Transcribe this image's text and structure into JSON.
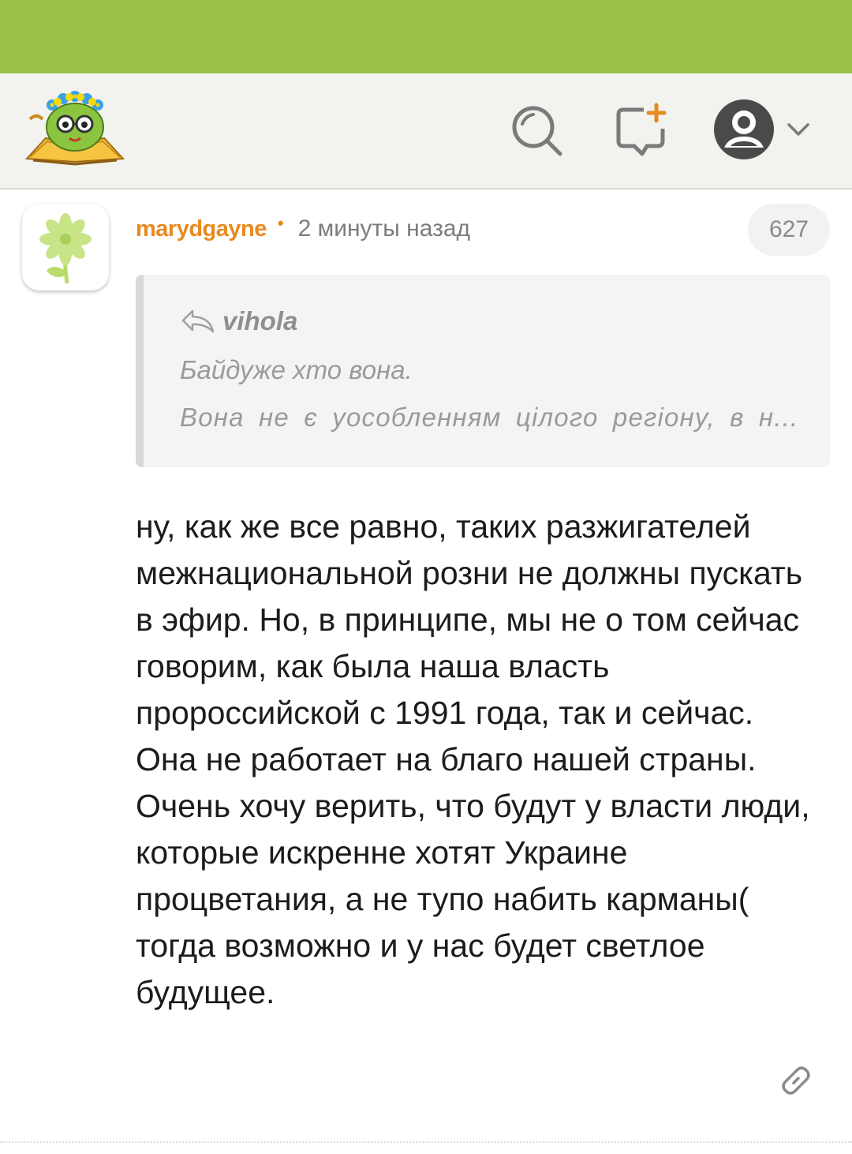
{
  "header": {
    "logo_icon": "kid-with-glasses-and-book-logo",
    "search_icon": "search-icon",
    "new_post_icon": "new-post-icon",
    "profile_icon": "user-avatar-icon",
    "dropdown_icon": "chevron-down-icon"
  },
  "comment": {
    "author": "marydgayne",
    "separator": "•",
    "time": "2 минуты назад",
    "rating": "627",
    "avatar_icon": "flower-icon",
    "quote": {
      "author": "vihola",
      "line1": "Байдуже хто вона.",
      "line2": "Вона не є уособленням цілого регіону, в н..."
    },
    "text": "ну, как же все равно, таких разжигателей межнациональной розни не должны пускать в эфир. Но, в принципе, мы не о том сейчас говорим, как была наша власть пророссийской с 1991 года, так и сейчас. Она не работает на благо нашей страны. Очень хочу верить, что будут у власти люди, которые искренне хотят Украине процветания, а не тупо набить карманы( тогда возможно и у нас будет светлое будущее.",
    "link_icon": "link-icon"
  },
  "colors": {
    "status_bar": "#9bc247",
    "header_bg": "#f2f2ee",
    "author": "#e88a1f",
    "text": "#1c1c1c"
  }
}
